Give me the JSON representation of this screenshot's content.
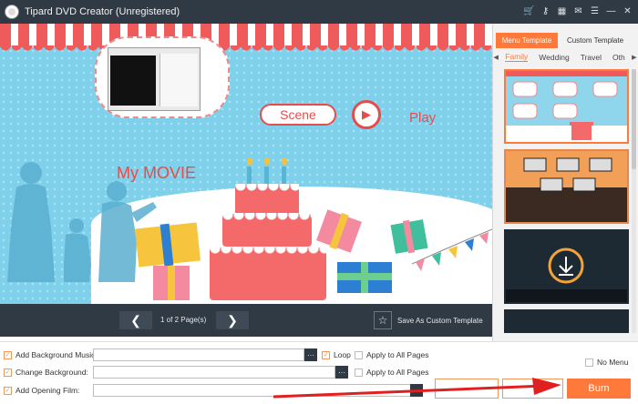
{
  "app": {
    "title": "Tipard DVD Creator (Unregistered)",
    "toolbar_icons": [
      "cart-icon",
      "key-icon",
      "save-icon",
      "feedback-icon",
      "menu-icon",
      "minimize-icon",
      "close-icon"
    ]
  },
  "preview": {
    "scene_label": "Scene",
    "play_label": "Play",
    "movie_title": "My MOVIE",
    "page_indicator": "1 of 2 Page(s)",
    "save_template_label": "Save As Custom Template"
  },
  "templates": {
    "tabs": [
      {
        "label": "Menu Template",
        "active": true
      },
      {
        "label": "Custom Template",
        "active": false
      }
    ],
    "categories": [
      {
        "label": "Family",
        "active": true
      },
      {
        "label": "Wedding",
        "active": false
      },
      {
        "label": "Travel",
        "active": false
      },
      {
        "label": "Oth",
        "active": false
      }
    ],
    "selected_index": 0
  },
  "options": {
    "background_music": {
      "label": "Add Background Music:",
      "checked": true,
      "value": "",
      "loop_label": "Loop",
      "loop_checked": true,
      "apply_label": "Apply to All Pages",
      "apply_checked": false
    },
    "change_background": {
      "label": "Change Background:",
      "checked": true,
      "value": "",
      "apply_label": "Apply to All Pages",
      "apply_checked": false
    },
    "opening_film": {
      "label": "Add Opening Film:",
      "checked": true,
      "value": ""
    },
    "no_menu_label": "No Menu",
    "no_menu_checked": false,
    "browse_label": "···",
    "burn_label": "Burn"
  },
  "colors": {
    "accent": "#ff7a3a",
    "titlebar": "#2f3a45",
    "arrow": "#e02020"
  }
}
